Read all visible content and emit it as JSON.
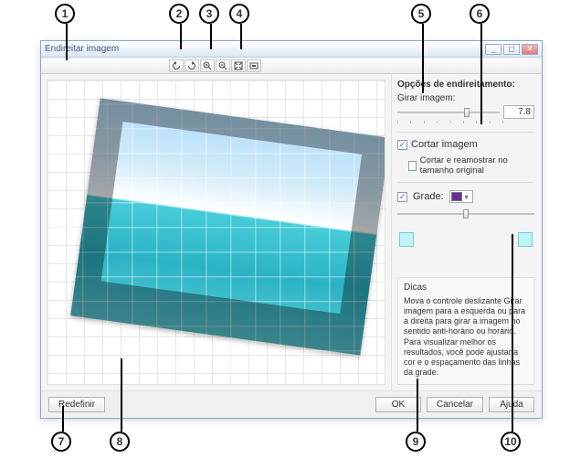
{
  "callouts": [
    "1",
    "2",
    "3",
    "4",
    "5",
    "6",
    "7",
    "8",
    "9",
    "10"
  ],
  "window": {
    "title": "Endireitar imagem"
  },
  "toolbar": {
    "rotate_left": "rotate-left",
    "rotate_right": "rotate-right",
    "zoom_in": "zoom-in",
    "zoom_out": "zoom-out",
    "fit": "fit-window",
    "actual": "actual-size"
  },
  "options": {
    "section_title": "Opções de endireitamento:",
    "rotate_label": "Girar imagem:",
    "rotate_value": "7.8",
    "crop_label": "Cortar imagem",
    "crop_checked": true,
    "resample_label": "Cortar e reamostrar no tamanho original",
    "resample_checked": false,
    "grid_label": "Grade:",
    "grid_checked": true,
    "grid_color": "#6b2b9a"
  },
  "tips": {
    "title": "Dicas",
    "body": "Mova o controle deslizante Girar imagem para a esquerda ou para a direita para girar a imagem no sentido anti-horário ou horário. Para visualizar melhor os resultados, você pode ajustar a cor e o espaçamento das linhas da grade."
  },
  "buttons": {
    "reset": "Redefinir",
    "ok": "OK",
    "cancel": "Cancelar",
    "help": "Ajuda"
  }
}
